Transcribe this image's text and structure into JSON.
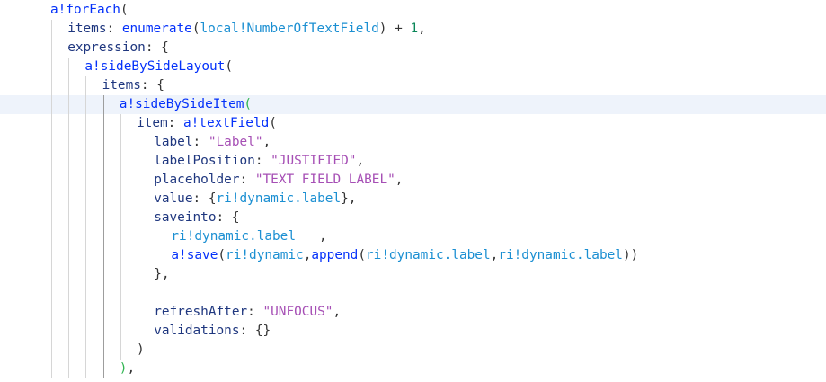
{
  "editor": {
    "lines": [
      {
        "indent": 0,
        "tokens": [
          [
            "fn",
            "a!forEach"
          ],
          [
            "pn",
            "("
          ]
        ]
      },
      {
        "indent": 1,
        "tokens": [
          [
            "id",
            "items"
          ],
          [
            "pn",
            ": "
          ],
          [
            "fn",
            "enumerate"
          ],
          [
            "pn",
            "("
          ],
          [
            "ref",
            "local!NumberOfTextField"
          ],
          [
            "pn",
            ") + "
          ],
          [
            "num",
            "1"
          ],
          [
            "pn",
            ","
          ]
        ]
      },
      {
        "indent": 1,
        "tokens": [
          [
            "id",
            "expression"
          ],
          [
            "pn",
            ": {"
          ]
        ]
      },
      {
        "indent": 2,
        "tokens": [
          [
            "fn",
            "a!sideBySideLayout"
          ],
          [
            "pn",
            "("
          ]
        ]
      },
      {
        "indent": 3,
        "tokens": [
          [
            "id",
            "items"
          ],
          [
            "pn",
            ": {"
          ]
        ]
      },
      {
        "indent": 4,
        "tokens": [
          [
            "fn",
            "a!sideBySideItem"
          ],
          [
            "brg",
            "("
          ]
        ],
        "current": true
      },
      {
        "indent": 5,
        "tokens": [
          [
            "id",
            "item"
          ],
          [
            "pn",
            ": "
          ],
          [
            "fn",
            "a!textField"
          ],
          [
            "pn",
            "("
          ]
        ]
      },
      {
        "indent": 6,
        "tokens": [
          [
            "id",
            "label"
          ],
          [
            "pn",
            ": "
          ],
          [
            "str2",
            "\"Label\""
          ],
          [
            "pn",
            ","
          ]
        ]
      },
      {
        "indent": 6,
        "tokens": [
          [
            "id",
            "labelPosition"
          ],
          [
            "pn",
            ": "
          ],
          [
            "str2",
            "\"JUSTIFIED\""
          ],
          [
            "pn",
            ","
          ]
        ]
      },
      {
        "indent": 6,
        "tokens": [
          [
            "id",
            "placeholder"
          ],
          [
            "pn",
            ": "
          ],
          [
            "str2",
            "\"TEXT FIELD LABEL\""
          ],
          [
            "pn",
            ","
          ]
        ]
      },
      {
        "indent": 6,
        "tokens": [
          [
            "id",
            "value"
          ],
          [
            "pn",
            ": {"
          ],
          [
            "ref",
            "ri!dynamic.label"
          ],
          [
            "pn",
            "},"
          ]
        ]
      },
      {
        "indent": 6,
        "tokens": [
          [
            "id",
            "saveinto"
          ],
          [
            "pn",
            ": {"
          ]
        ]
      },
      {
        "indent": 7,
        "tokens": [
          [
            "ref",
            "ri!dynamic.label"
          ],
          [
            "pn",
            "   ,"
          ]
        ]
      },
      {
        "indent": 7,
        "tokens": [
          [
            "fn",
            "a!save"
          ],
          [
            "pn",
            "("
          ],
          [
            "ref",
            "ri!dynamic"
          ],
          [
            "pn",
            ","
          ],
          [
            "fn",
            "append"
          ],
          [
            "pn",
            "("
          ],
          [
            "ref",
            "ri!dynamic.label"
          ],
          [
            "pn",
            ","
          ],
          [
            "ref",
            "ri!dynamic.label"
          ],
          [
            "pn",
            "))"
          ]
        ]
      },
      {
        "indent": 6,
        "tokens": [
          [
            "pn",
            "},"
          ]
        ]
      },
      {
        "indent": 6,
        "tokens": []
      },
      {
        "indent": 6,
        "tokens": [
          [
            "id",
            "refreshAfter"
          ],
          [
            "pn",
            ": "
          ],
          [
            "str2",
            "\"UNFOCUS\""
          ],
          [
            "pn",
            ","
          ]
        ]
      },
      {
        "indent": 6,
        "tokens": [
          [
            "id",
            "validations"
          ],
          [
            "pn",
            ": {}"
          ]
        ]
      },
      {
        "indent": 5,
        "tokens": [
          [
            "pn",
            ")"
          ]
        ]
      },
      {
        "indent": 4,
        "tokens": [
          [
            "brg",
            ")"
          ],
          [
            "pn",
            ","
          ]
        ]
      }
    ]
  }
}
